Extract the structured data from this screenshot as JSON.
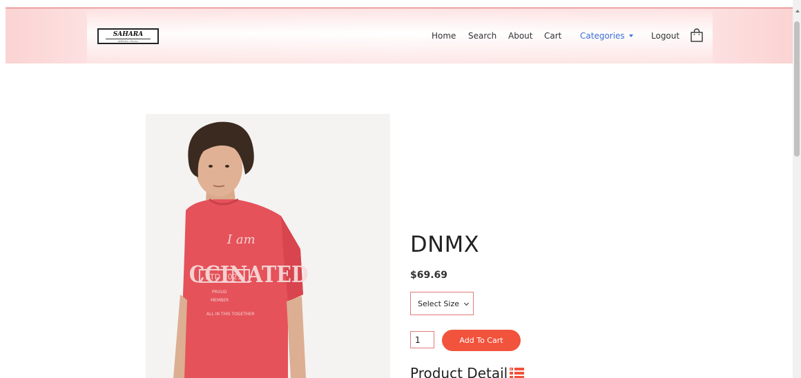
{
  "brand": {
    "name": "SAHARA",
    "tagline": "athletic choice"
  },
  "nav": {
    "home": "Home",
    "search": "Search",
    "about": "About",
    "cart": "Cart",
    "categories": "Categories",
    "logout": "Logout"
  },
  "product": {
    "title": "DNMX",
    "price": "$69.69",
    "size_select": "Select Size",
    "quantity": "1",
    "add_to_cart": "Add To Cart",
    "detail_heading": "Product Detail"
  },
  "colors": {
    "accent": "#f2533c",
    "link": "#3d6fd8",
    "header_tint": "#fbd3d3"
  }
}
